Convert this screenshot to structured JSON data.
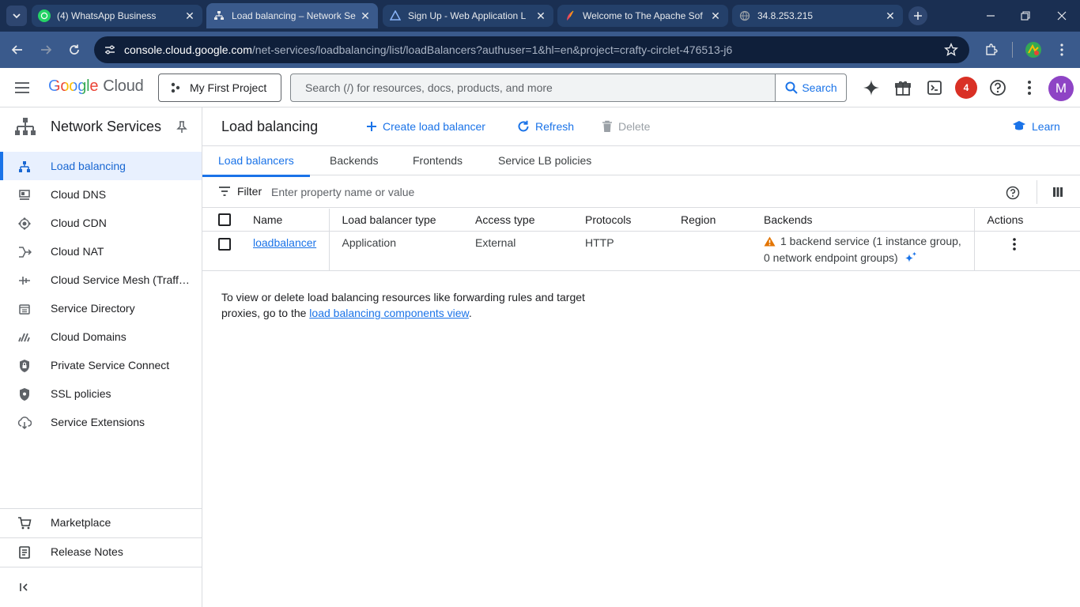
{
  "browser": {
    "tabs": [
      {
        "title": "(4) WhatsApp Business",
        "icon": "whatsapp-icon"
      },
      {
        "title": "Load balancing – Network Se",
        "icon": "load-balancing-icon"
      },
      {
        "title": "Sign Up - Web Application L",
        "icon": "web-app-icon"
      },
      {
        "title": "Welcome to The Apache Sof",
        "icon": "apache-feather-icon"
      },
      {
        "title": "34.8.253.215",
        "icon": "globe-icon"
      }
    ],
    "url_host": "console.cloud.google.com",
    "url_path": "/net-services/loadbalancing/list/loadBalancers?authuser=1&hl=en&project=crafty-circlet-476513-j6"
  },
  "header": {
    "logo_google": "Google",
    "logo_cloud": "Cloud",
    "project": "My First Project",
    "search_placeholder": "Search (/) for resources, docs, products, and more",
    "search_button": "Search",
    "notification_count": "4",
    "avatar_initial": "M"
  },
  "sidebar": {
    "title": "Network Services",
    "items": [
      {
        "label": "Load balancing",
        "icon": "load-balancing-icon",
        "active": true
      },
      {
        "label": "Cloud DNS",
        "icon": "dns-icon"
      },
      {
        "label": "Cloud CDN",
        "icon": "cdn-icon"
      },
      {
        "label": "Cloud NAT",
        "icon": "nat-icon"
      },
      {
        "label": "Cloud Service Mesh (Traffic Director)",
        "icon": "service-mesh-icon"
      },
      {
        "label": "Service Directory",
        "icon": "service-directory-icon"
      },
      {
        "label": "Cloud Domains",
        "icon": "domains-icon"
      },
      {
        "label": "Private Service Connect",
        "icon": "private-connect-icon"
      },
      {
        "label": "SSL policies",
        "icon": "ssl-shield-icon"
      },
      {
        "label": "Service Extensions",
        "icon": "extensions-icon"
      }
    ],
    "marketplace": "Marketplace",
    "release_notes": "Release Notes"
  },
  "main": {
    "title": "Load balancing",
    "create_label": "Create load balancer",
    "refresh_label": "Refresh",
    "delete_label": "Delete",
    "learn_label": "Learn",
    "tabs": [
      "Load balancers",
      "Backends",
      "Frontends",
      "Service LB policies"
    ],
    "filter_label": "Filter",
    "filter_placeholder": "Enter property name or value",
    "columns": [
      "Name",
      "Load balancer type",
      "Access type",
      "Protocols",
      "Region",
      "Backends",
      "Actions"
    ],
    "rows": [
      {
        "name": "loadbalancer",
        "type": "Application",
        "access": "External",
        "protocols": "HTTP",
        "region": "",
        "backends_line1": "1 backend service (1 instance group,",
        "backends_line2": "0 network endpoint groups)"
      }
    ],
    "note_prefix": "To view or delete load balancing resources like forwarding rules and target proxies, go to the ",
    "note_link": "load balancing components view",
    "note_suffix": "."
  },
  "colors": {
    "accent": "#1a73e8",
    "warning": "#e37400",
    "notification": "#d93025",
    "avatar": "#8e44c5"
  }
}
